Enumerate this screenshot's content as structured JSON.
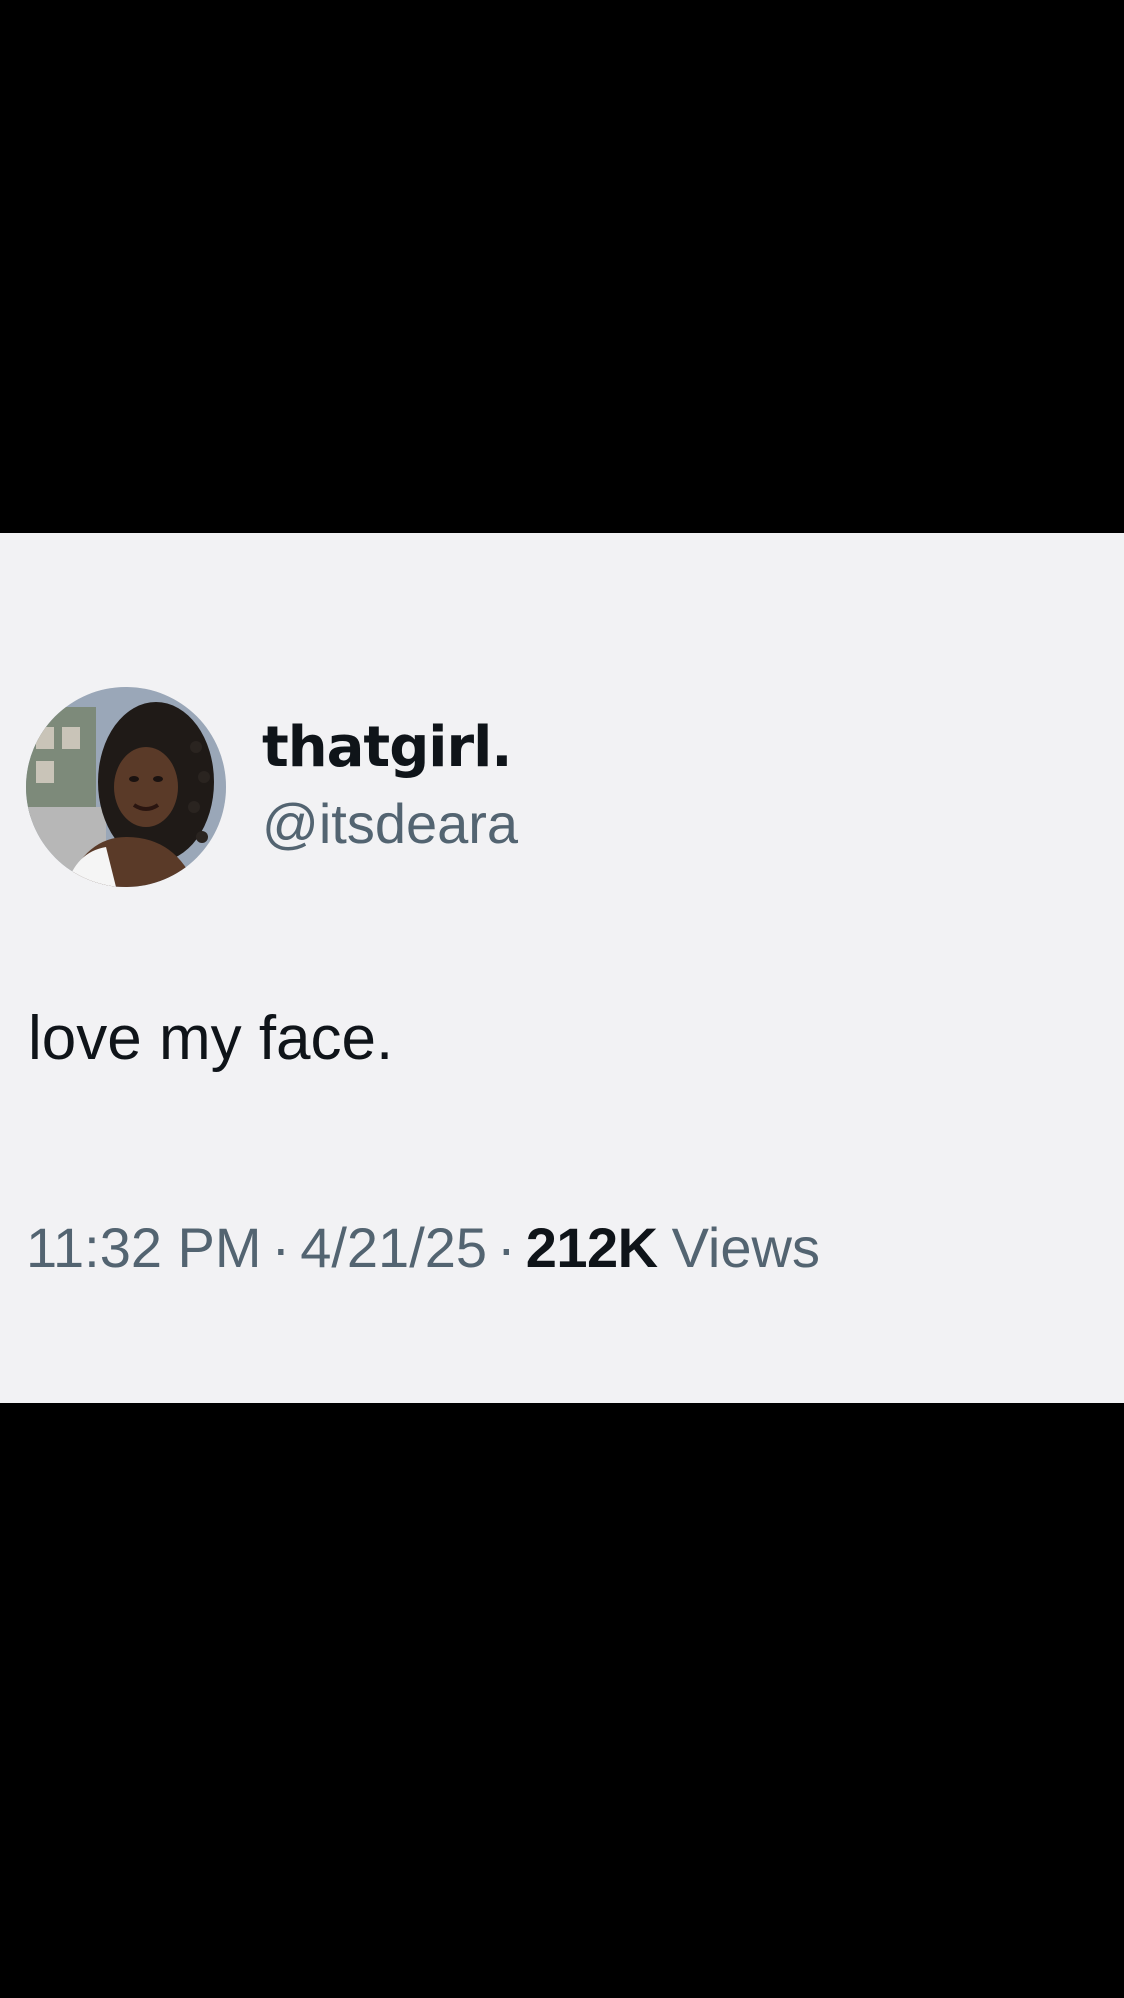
{
  "tweet": {
    "author": {
      "display_name": "thatgirl.",
      "handle": "@itsdeara"
    },
    "text": "love my face.",
    "time": "11:32 PM",
    "date": "4/21/25",
    "separator": "·",
    "views_count": "212K",
    "views_label": "Views"
  },
  "colors": {
    "background": "#000000",
    "card": "#f2f2f4",
    "primary_text": "#0f1419",
    "secondary_text": "#536471"
  }
}
